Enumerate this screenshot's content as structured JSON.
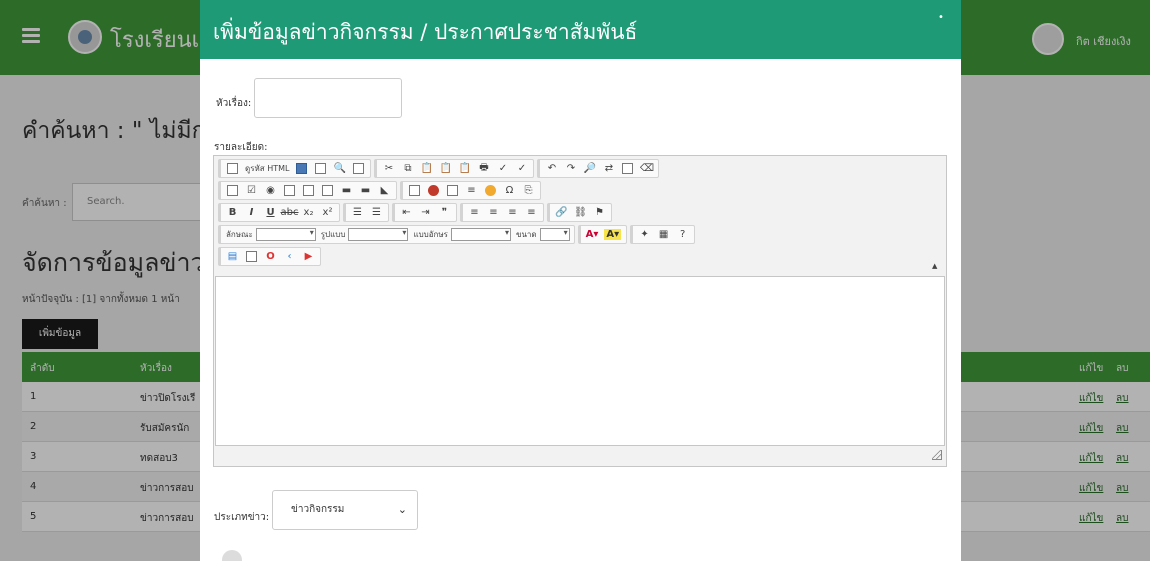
{
  "header": {
    "site_title": "โรงเรียนเ",
    "user_name": "กิต เชียงเงิง"
  },
  "background": {
    "search_title": "คำค้นหา : \" ไม่มีก",
    "search_label": "คำค้นหา :",
    "search_placeholder": "Search.",
    "manage_title": "จัดการข้อมูลข่าวก",
    "page_info": "หน้าปัจจุบัน : [1] จากทั้งหมด 1 หน้า",
    "add_button": "เพิ่มข้อมูล",
    "table": {
      "headers": {
        "num": "ลำดับ",
        "title": "หัวเรื่อง",
        "edit": "แก้ไข",
        "del": "ลบ"
      },
      "rows": [
        {
          "num": "1",
          "title": "ข่าวปิดโรงเรี",
          "edit": "แก้ไข",
          "del": "ลบ"
        },
        {
          "num": "2",
          "title": "รับสมัครนัก",
          "edit": "แก้ไข",
          "del": "ลบ"
        },
        {
          "num": "3",
          "title": "ทดสอบ3",
          "edit": "แก้ไข",
          "del": "ลบ"
        },
        {
          "num": "4",
          "title": "ข่าวการสอบ",
          "edit": "แก้ไข",
          "del": "ลบ"
        },
        {
          "num": "5",
          "title": "ข่าวการสอบ",
          "edit": "แก้ไข",
          "del": "ลบ"
        }
      ]
    }
  },
  "modal": {
    "title": "เพิ่มข้อมูลข่าวกิจกรรม / ประกาศประชาสัมพันธ์",
    "close_glyph": "•",
    "subject_label": "หัวเรื่อง:",
    "subject_value": "",
    "detail_label": "รายละเอียด:",
    "toolbar": {
      "source_label": "ดูรหัส HTML",
      "style_label": "ลักษณะ",
      "format_label": "รูปแบบ",
      "font_label": "แบบอักษร",
      "size_label": "ขนาด"
    },
    "type_label": "ประเภทข่าว:",
    "type_value": "ข่าวกิจกรรม"
  }
}
